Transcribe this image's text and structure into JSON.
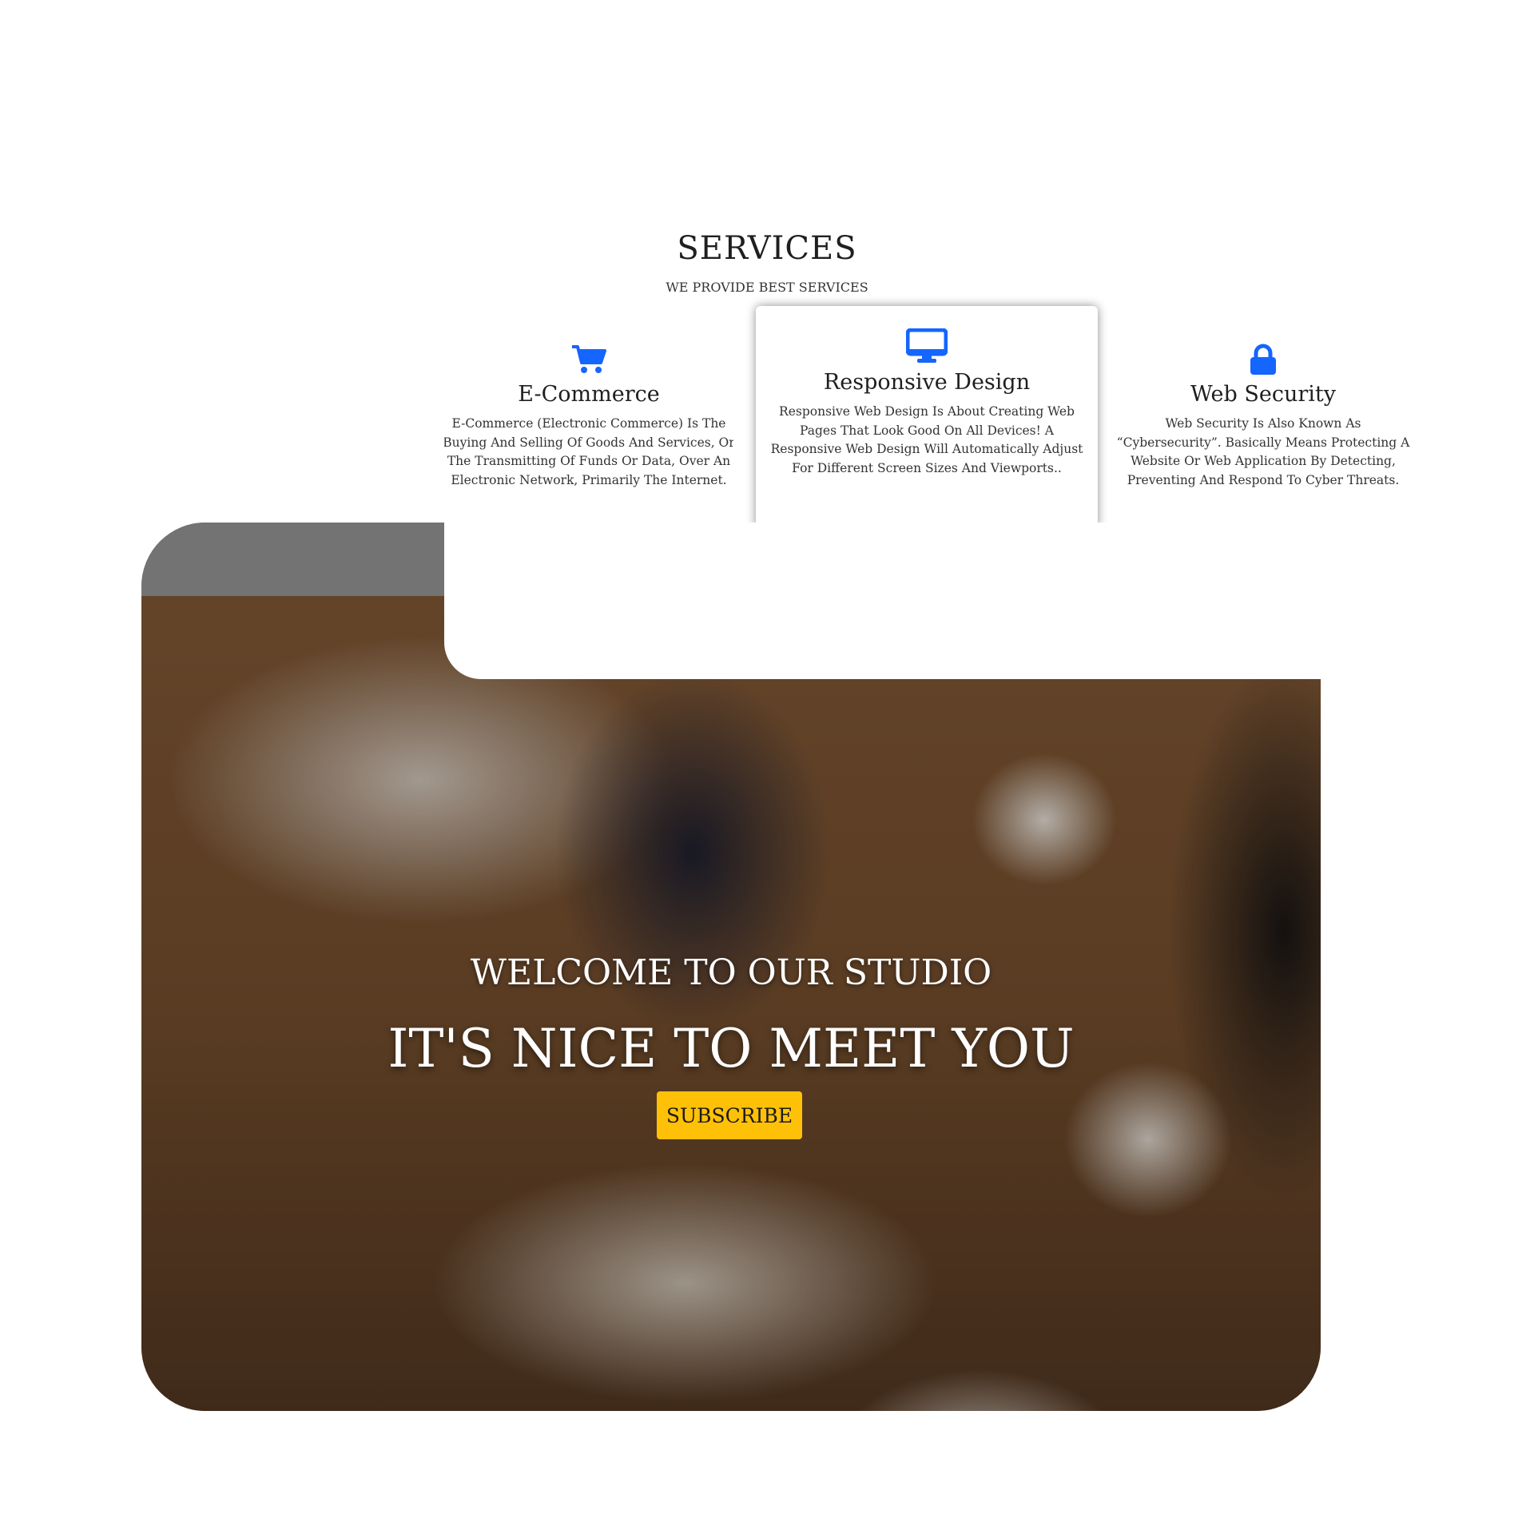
{
  "services": {
    "title": "SERVICES",
    "subtitle": "WE PROVIDE BEST SERVICES",
    "accent_color": "#1565ff",
    "cards": [
      {
        "icon": "shopping-cart-icon",
        "title": "E-Commerce",
        "text": "E-Commerce (Electronic Commerce) Is The Buying And Selling Of Goods And Services, Or The Transmitting Of Funds Or Data, Over An Electronic Network, Primarily The Internet.",
        "highlighted": false
      },
      {
        "icon": "desktop-monitor-icon",
        "title": "Responsive Design",
        "text": "Responsive Web Design Is About Creating Web Pages That Look Good On All Devices! A Responsive Web Design Will Automatically Adjust For Different Screen Sizes And Viewports..",
        "highlighted": true
      },
      {
        "icon": "lock-icon",
        "title": "Web Security",
        "text": "Web Security Is Also Known As “Cybersecurity”. Basically Means Protecting A Website Or Web Application By Detecting, Preventing And Respond To Cyber Threats.",
        "highlighted": false
      }
    ]
  },
  "hero": {
    "welcome": "WELCOME TO OUR STUDIO",
    "headline": "IT'S NICE TO MEET YOU",
    "button_label": "SUBSCRIBE",
    "button_color": "#ffc107"
  }
}
